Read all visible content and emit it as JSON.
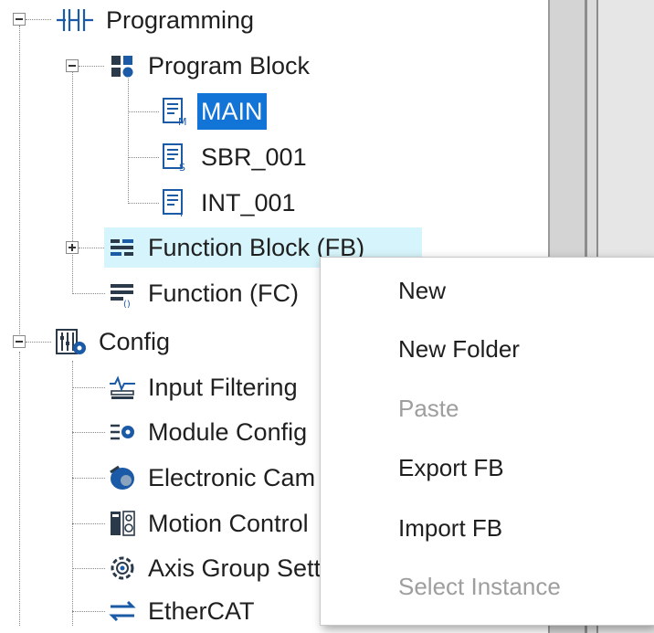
{
  "tree": {
    "items": [
      {
        "label": "Programming",
        "icon": "ladder-icon"
      },
      {
        "label": "Program Block",
        "icon": "program-block-icon"
      },
      {
        "label": "MAIN",
        "icon": "doc-m-icon",
        "selected": true
      },
      {
        "label": "SBR_001",
        "icon": "doc-s-icon"
      },
      {
        "label": "INT_001",
        "icon": "doc-i-icon"
      },
      {
        "label": "Function Block (FB)",
        "icon": "function-block-icon",
        "hover": true
      },
      {
        "label": "Function (FC)",
        "icon": "function-icon"
      },
      {
        "label": "Config",
        "icon": "config-icon"
      },
      {
        "label": "Input Filtering",
        "icon": "input-filter-icon"
      },
      {
        "label": "Module Config",
        "icon": "module-config-icon"
      },
      {
        "label": "Electronic Cam",
        "icon": "electronic-cam-icon"
      },
      {
        "label": "Motion Control",
        "icon": "motion-control-icon"
      },
      {
        "label": "Axis Group Setting",
        "icon": "axis-group-icon"
      },
      {
        "label": "EtherCAT",
        "icon": "ethercat-icon"
      }
    ]
  },
  "context_menu": {
    "items": [
      {
        "label": "New",
        "enabled": true
      },
      {
        "label": "New Folder",
        "enabled": true
      },
      {
        "label": "Paste",
        "enabled": false
      },
      {
        "label": "Export FB",
        "enabled": true
      },
      {
        "label": "Import FB",
        "enabled": true
      },
      {
        "label": "Select Instance",
        "enabled": false
      }
    ]
  },
  "colors": {
    "selection": "#1374d8",
    "hover": "#d6f4fb",
    "icon_blue": "#1b5aa6",
    "disabled_text": "#9e9e9e"
  }
}
